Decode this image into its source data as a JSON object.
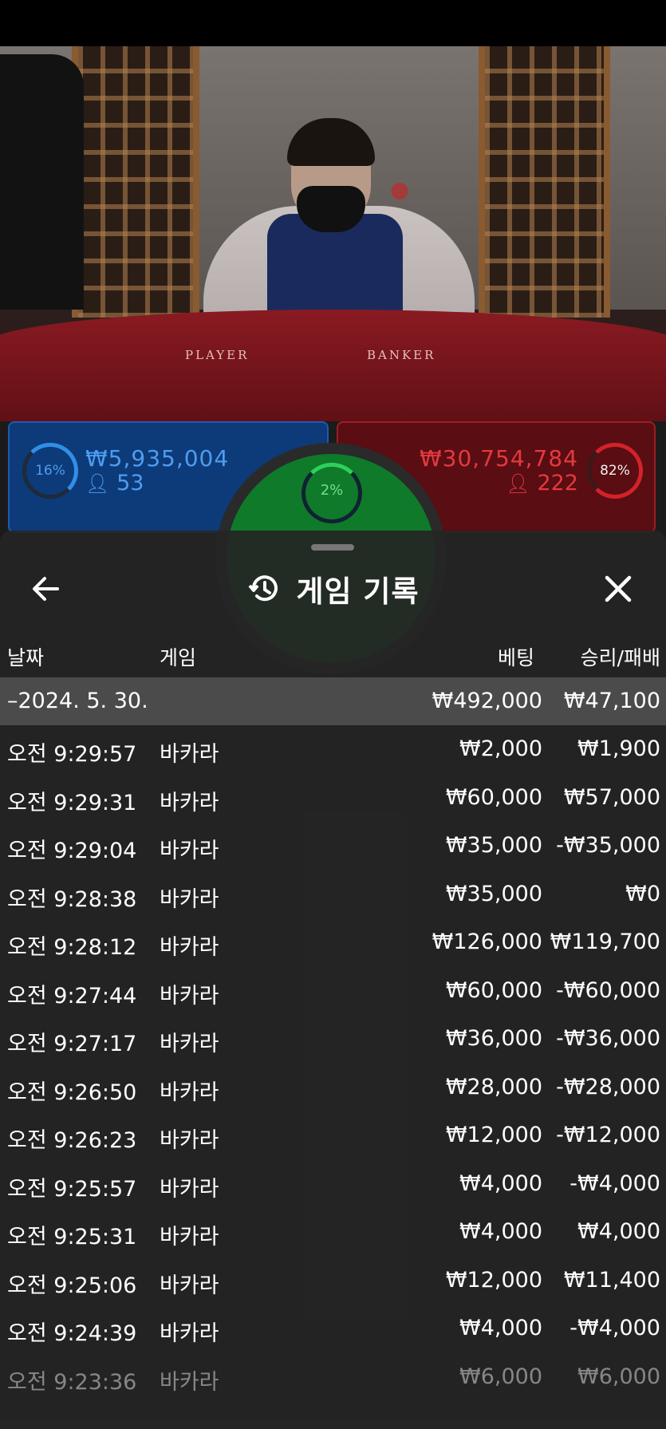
{
  "video": {
    "table_player_word": "PLAYER",
    "table_banker_word": "BANKER"
  },
  "bets": {
    "player": {
      "percent": "16%",
      "amount": "₩5,935,004",
      "users": "53",
      "color": "#2f8fe8"
    },
    "tie": {
      "percent": "2%",
      "color": "#2fd05a"
    },
    "banker": {
      "percent": "82%",
      "amount": "₩30,754,784",
      "users": "222",
      "color": "#d3222a"
    }
  },
  "sheet": {
    "title": "게임 기록",
    "headers": {
      "date": "날짜",
      "game": "게임",
      "bet": "베팅",
      "result": "승리/패배"
    },
    "summary": {
      "date": "–2024. 5. 30.",
      "bet": "₩492,000",
      "result": "₩47,100"
    },
    "rows": [
      {
        "time": "오전 9:29:57",
        "game": "바카라",
        "bet": "₩2,000",
        "result": "₩1,900"
      },
      {
        "time": "오전 9:29:31",
        "game": "바카라",
        "bet": "₩60,000",
        "result": "₩57,000"
      },
      {
        "time": "오전 9:29:04",
        "game": "바카라",
        "bet": "₩35,000",
        "result": "-₩35,000"
      },
      {
        "time": "오전 9:28:38",
        "game": "바카라",
        "bet": "₩35,000",
        "result": "₩0"
      },
      {
        "time": "오전 9:28:12",
        "game": "바카라",
        "bet": "₩126,000",
        "result": "₩119,700"
      },
      {
        "time": "오전 9:27:44",
        "game": "바카라",
        "bet": "₩60,000",
        "result": "-₩60,000"
      },
      {
        "time": "오전 9:27:17",
        "game": "바카라",
        "bet": "₩36,000",
        "result": "-₩36,000"
      },
      {
        "time": "오전 9:26:50",
        "game": "바카라",
        "bet": "₩28,000",
        "result": "-₩28,000"
      },
      {
        "time": "오전 9:26:23",
        "game": "바카라",
        "bet": "₩12,000",
        "result": "-₩12,000"
      },
      {
        "time": "오전 9:25:57",
        "game": "바카라",
        "bet": "₩4,000",
        "result": "-₩4,000"
      },
      {
        "time": "오전 9:25:31",
        "game": "바카라",
        "bet": "₩4,000",
        "result": "₩4,000"
      },
      {
        "time": "오전 9:25:06",
        "game": "바카라",
        "bet": "₩12,000",
        "result": "₩11,400"
      },
      {
        "time": "오전 9:24:39",
        "game": "바카라",
        "bet": "₩4,000",
        "result": "-₩4,000"
      },
      {
        "time": "오전 9:23:36",
        "game": "바카라",
        "bet": "₩6,000",
        "result": "₩6,000"
      }
    ],
    "icons": {
      "back": "arrow-left-icon",
      "history": "history-icon",
      "close": "close-icon"
    }
  }
}
